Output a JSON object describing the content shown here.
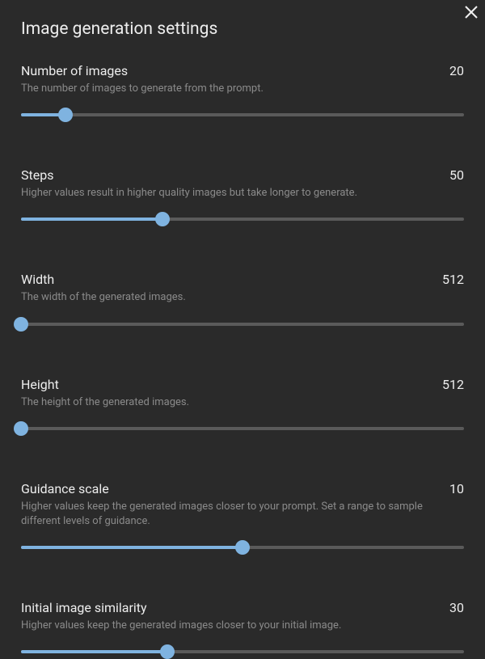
{
  "title": "Image generation settings",
  "settings": [
    {
      "label": "Number of images",
      "value": "20",
      "description": "The number of images to generate from the prompt.",
      "fillPercent": 10
    },
    {
      "label": "Steps",
      "value": "50",
      "description": "Higher values result in higher quality images but take longer to generate.",
      "fillPercent": 32
    },
    {
      "label": "Width",
      "value": "512",
      "description": "The width of the generated images.",
      "fillPercent": 0
    },
    {
      "label": "Height",
      "value": "512",
      "description": "The height of the generated images.",
      "fillPercent": 0
    },
    {
      "label": "Guidance scale",
      "value": "10",
      "description": "Higher values keep the generated images closer to your prompt. Set a range to sample different levels of guidance.",
      "fillPercent": 50
    },
    {
      "label": "Initial image similarity",
      "value": "30",
      "description": "Higher values keep the generated images closer to your initial image.",
      "fillPercent": 33
    }
  ]
}
